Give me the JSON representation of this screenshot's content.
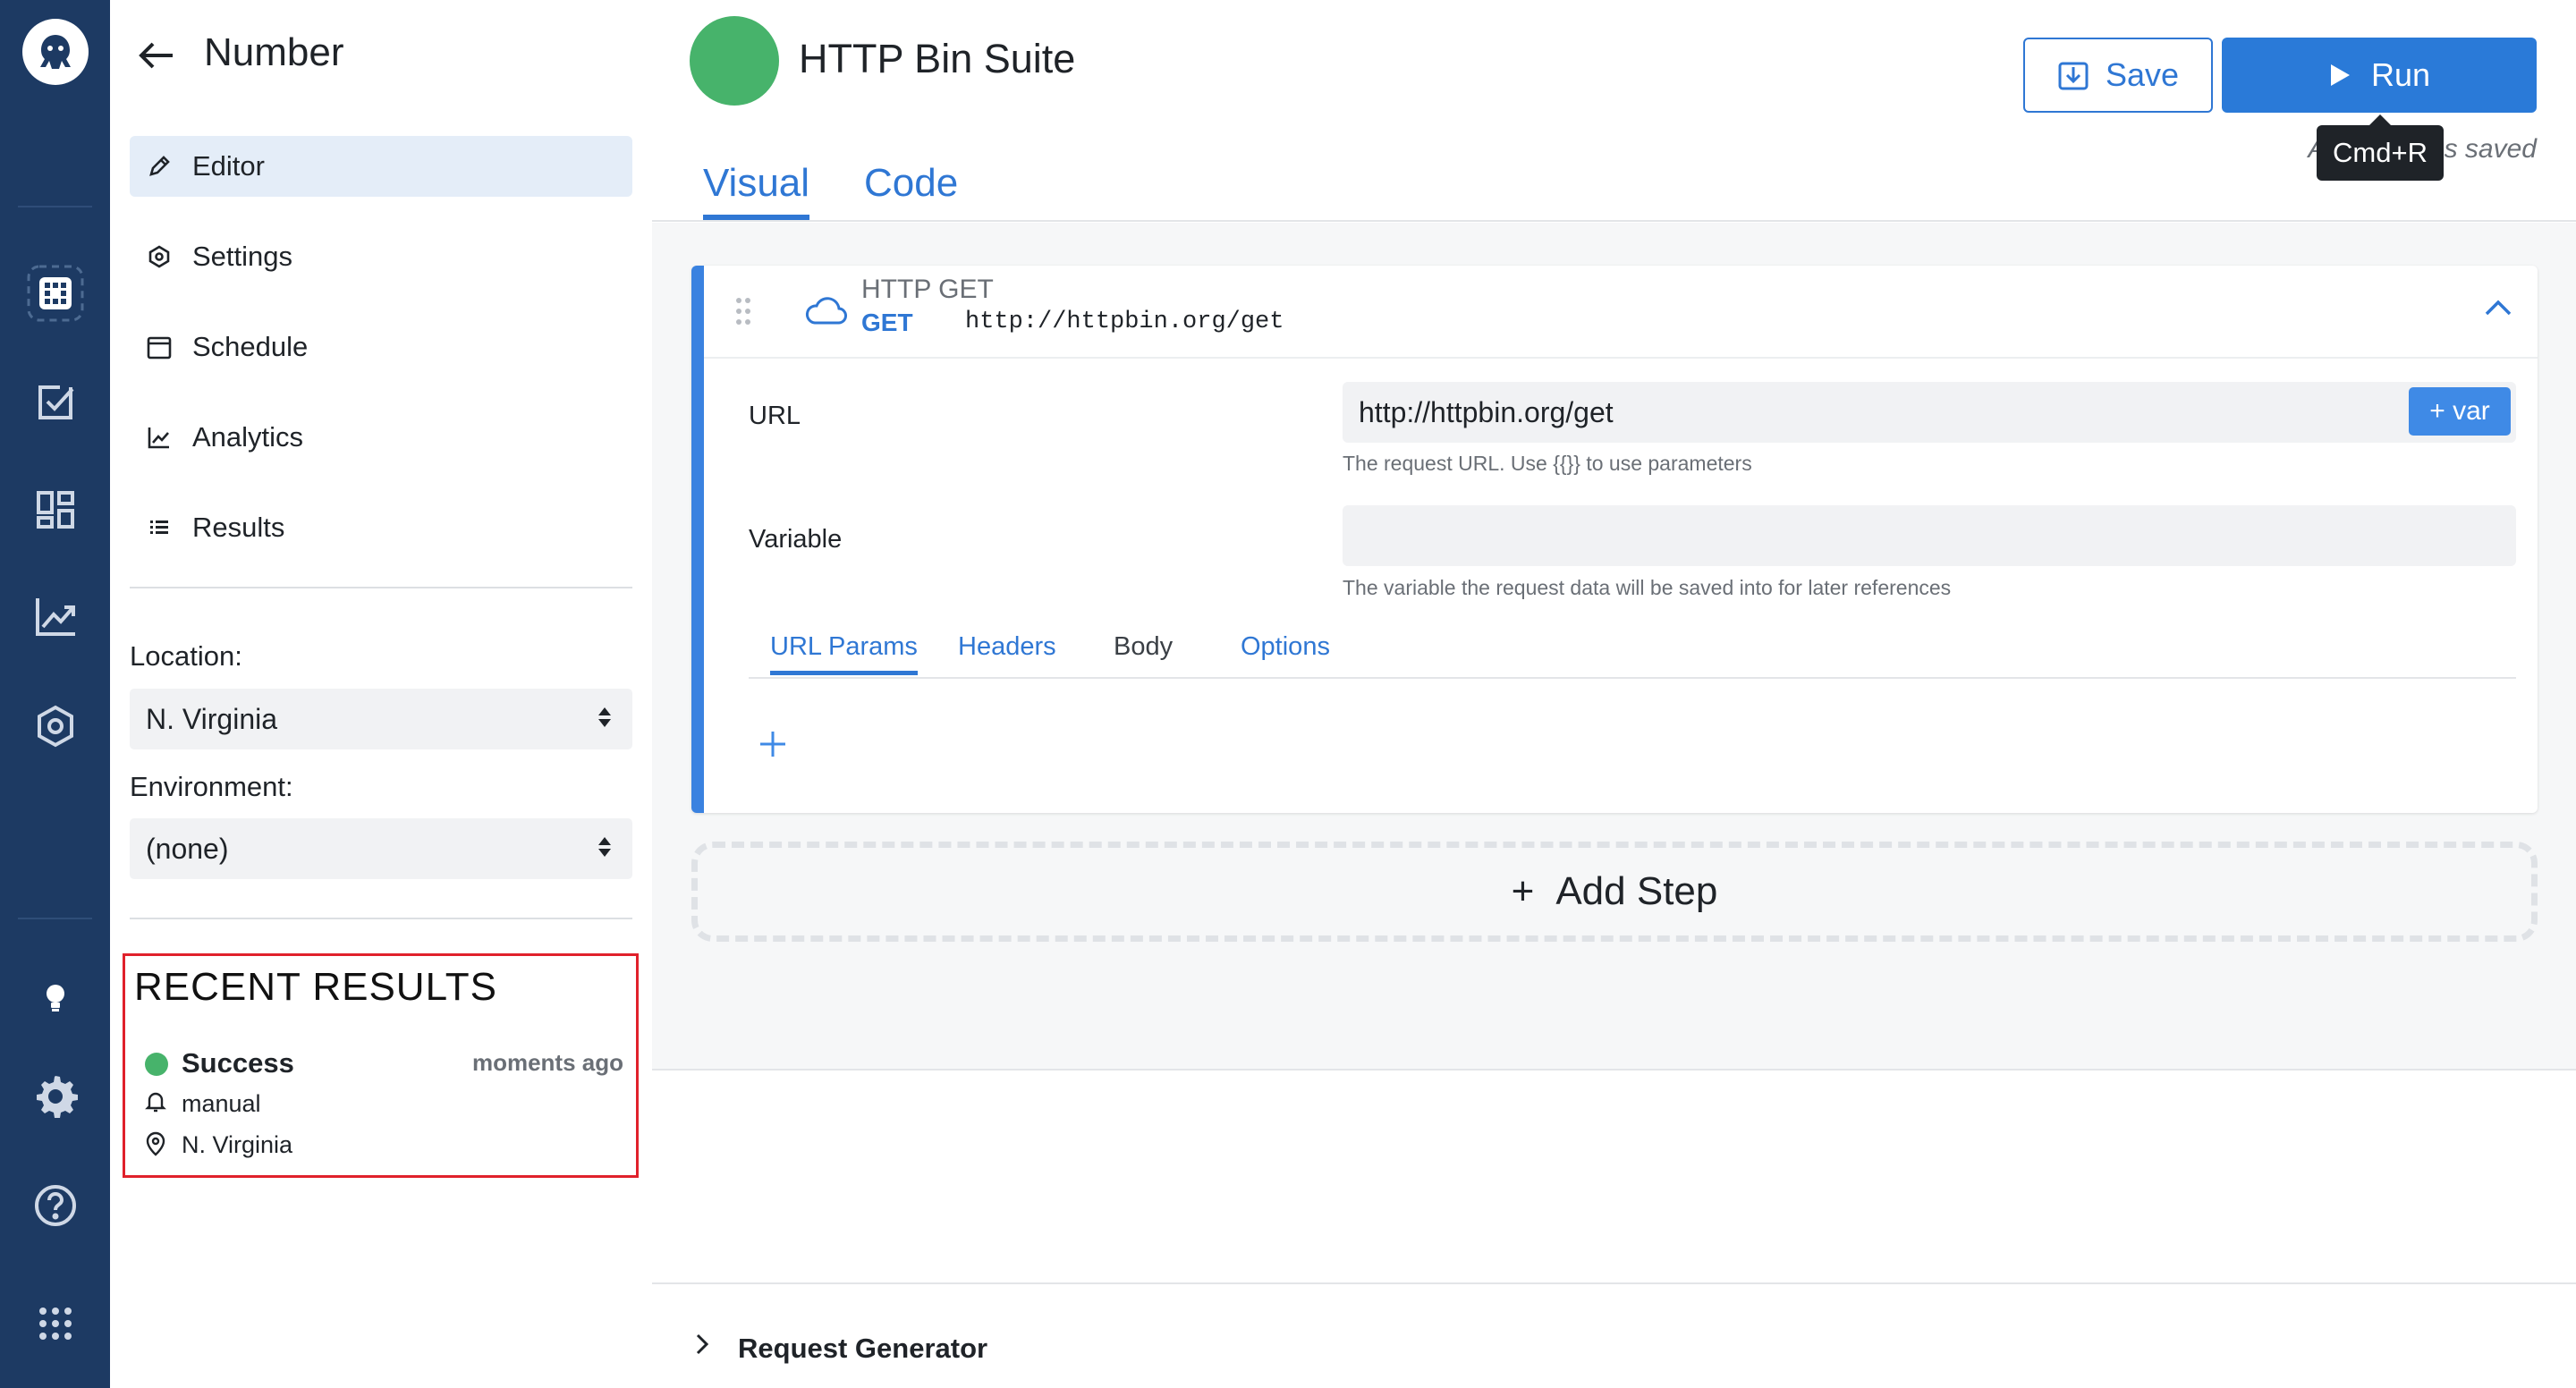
{
  "rail": {
    "icons": [
      "checkly-logo-icon",
      "checks-icon",
      "todo-icon",
      "dashboard-icon",
      "reporting-icon",
      "hexagon-settings-icon",
      "lightbulb-icon",
      "gear-icon",
      "help-icon",
      "apps-grid-icon"
    ]
  },
  "sidebar": {
    "title": "Number",
    "nav": [
      {
        "label": "Editor",
        "icon": "pencil-icon"
      },
      {
        "label": "Settings",
        "icon": "settings-icon"
      },
      {
        "label": "Schedule",
        "icon": "calendar-icon"
      },
      {
        "label": "Analytics",
        "icon": "chart-line-icon"
      },
      {
        "label": "Results",
        "icon": "list-icon"
      }
    ],
    "location_label": "Location:",
    "location_value": "N. Virginia",
    "environment_label": "Environment:",
    "environment_value": "(none)",
    "recent": {
      "title": "RECENT RESULTS",
      "status": "Success",
      "time": "moments ago",
      "trigger": "manual",
      "location": "N. Virginia"
    }
  },
  "header": {
    "suite_title": "HTTP Bin Suite",
    "save_label": "Save",
    "run_label": "Run",
    "tooltip": "Cmd+R",
    "autosave_text": "A                s saved"
  },
  "tabs": [
    "Visual",
    "Code"
  ],
  "step": {
    "name": "HTTP GET",
    "method": "GET",
    "url": "http://httpbin.org/get",
    "url_label": "URL",
    "url_value": "http://httpbin.org/get",
    "var_button": "+ var",
    "url_help": "The request URL. Use {{}} to use parameters",
    "variable_label": "Variable",
    "variable_value": "",
    "variable_help": "The variable the request data will be saved into for later references",
    "sub_tabs": [
      "URL Params",
      "Headers",
      "Body",
      "Options"
    ]
  },
  "add_step_label": "Add Step",
  "generator_title": "Request Generator",
  "colors": {
    "accent": "#2f77d4",
    "rail": "#1d3a63",
    "success": "#47b36b",
    "highlight": "#e0212b"
  }
}
